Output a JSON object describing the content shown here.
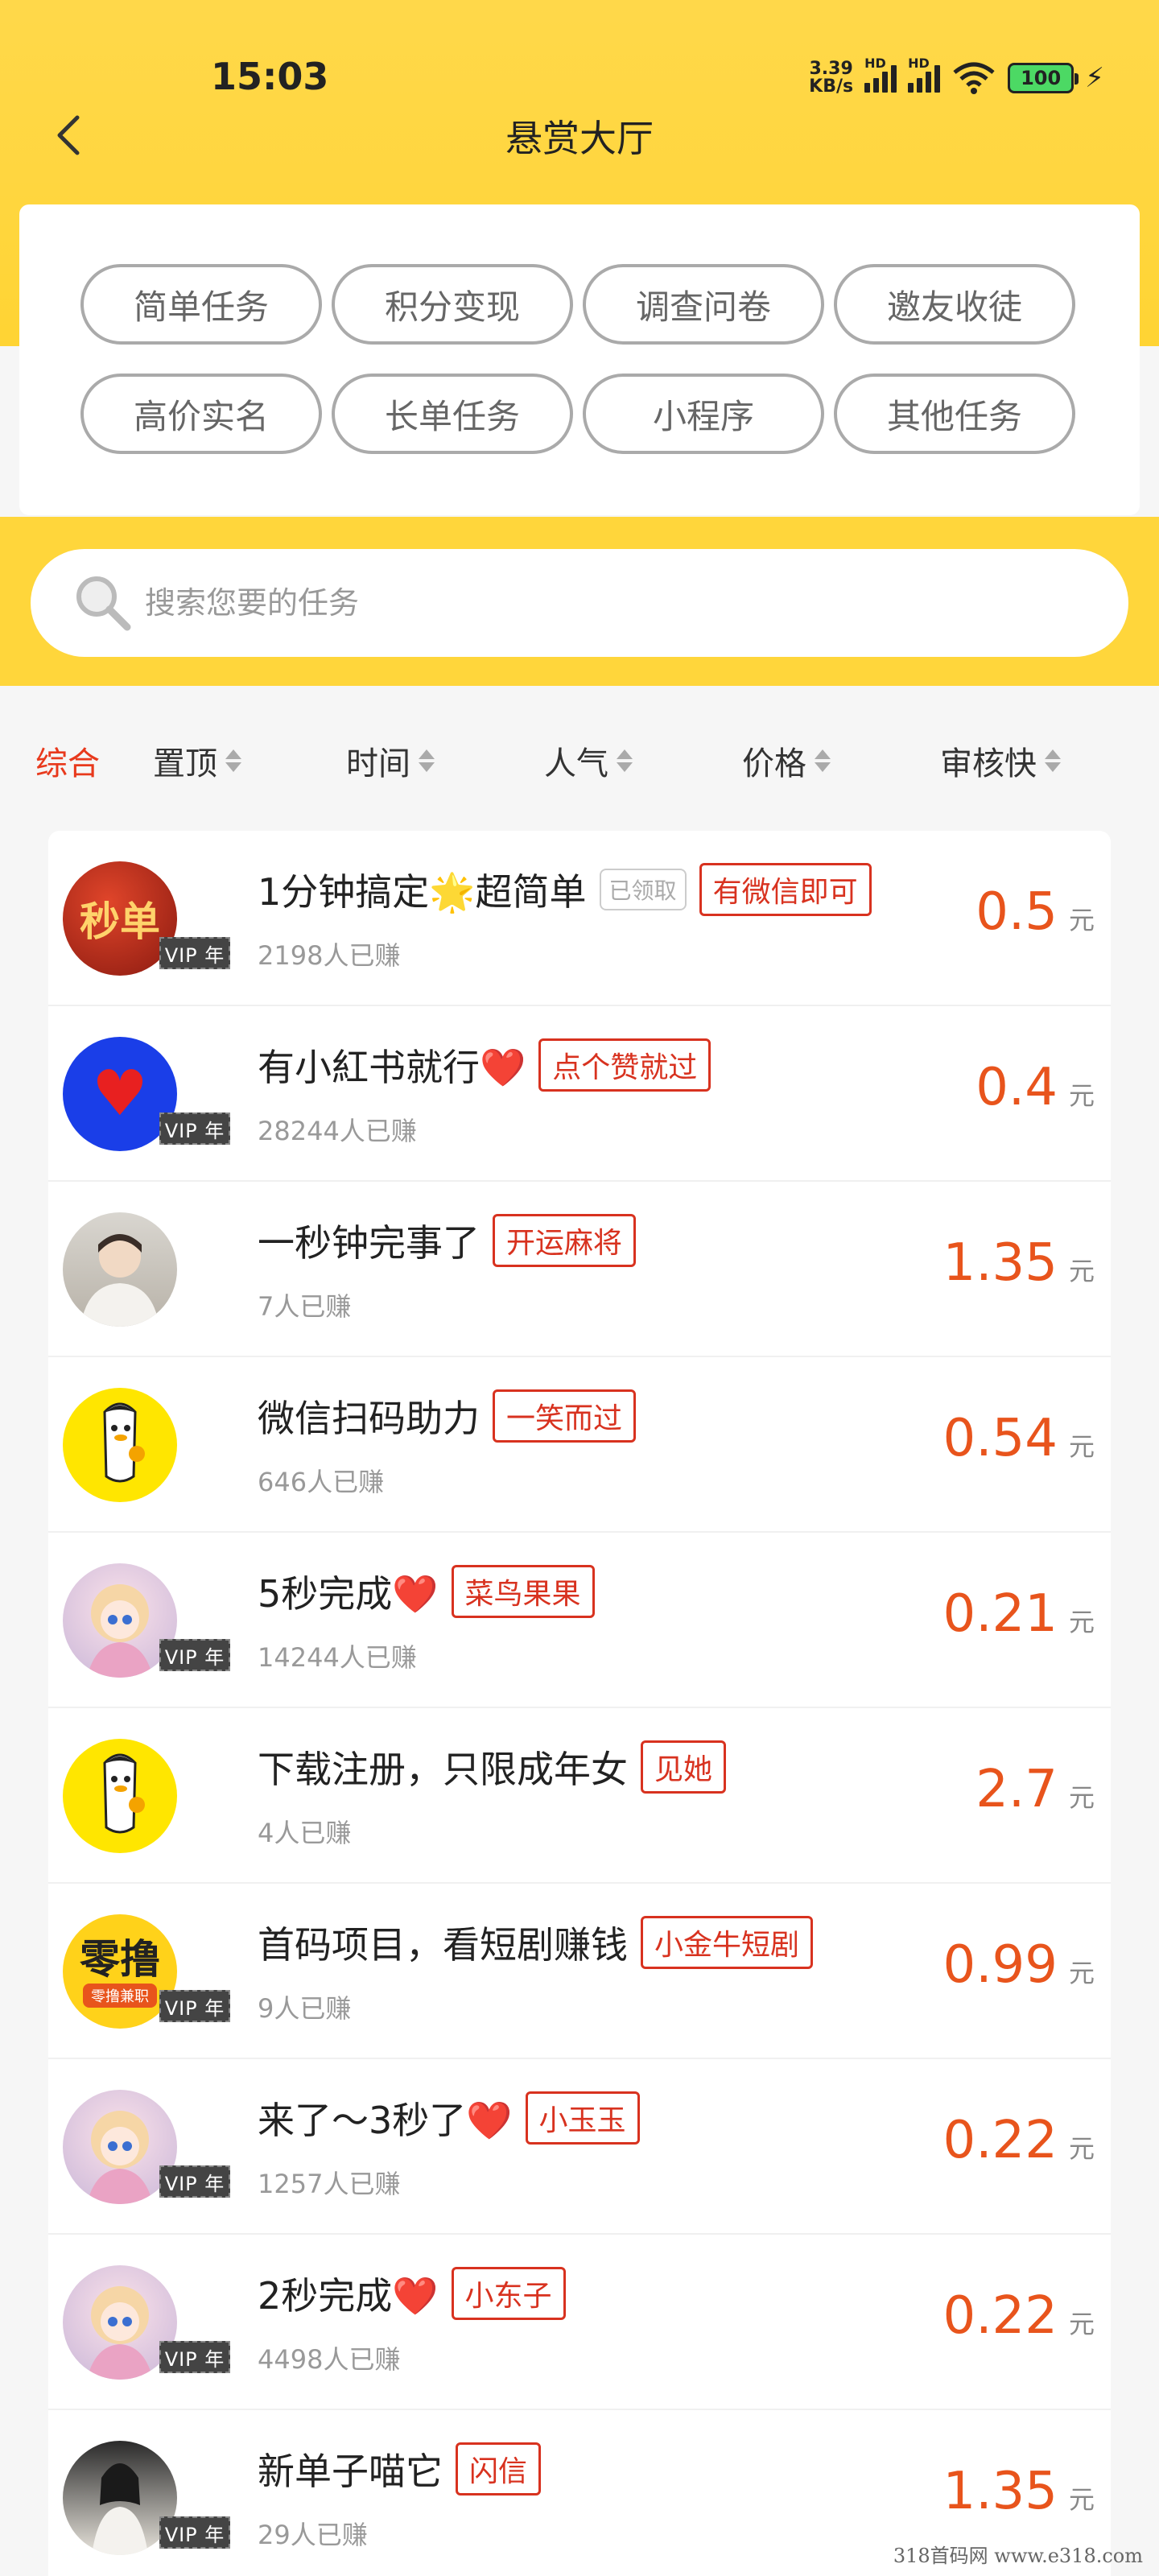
{
  "status_bar": {
    "time": "15:03",
    "net_speed_value": "3.39",
    "net_speed_unit": "KB/s",
    "hd1": "HD",
    "hd2": "HD",
    "battery": "100"
  },
  "nav": {
    "title": "悬赏大厅"
  },
  "categories": [
    "简单任务",
    "积分变现",
    "调查问卷",
    "邀友收徒",
    "高价实名",
    "长单任务",
    "小程序",
    "其他任务"
  ],
  "search": {
    "placeholder": "搜索您要的任务"
  },
  "sort": {
    "items": [
      "综合",
      "置顶",
      "时间",
      "人气",
      "价格",
      "审核快"
    ],
    "active": "综合"
  },
  "tasks": [
    {
      "title": "1分钟搞定🌟超简单",
      "claimed": "已领取",
      "tag": "有微信即可",
      "earned": "2198人已赚",
      "price": "0.5",
      "unit": "元",
      "vip": "VIP 年",
      "avatar_text": "秒单"
    },
    {
      "title": "有小紅书就行❤️",
      "tag": "点个赞就过",
      "earned": "28244人已赚",
      "price": "0.4",
      "unit": "元",
      "vip": "VIP 年"
    },
    {
      "title": "一秒钟完事了",
      "tag": "开运麻将",
      "earned": "7人已赚",
      "price": "1.35",
      "unit": "元"
    },
    {
      "title": "微信扫码助力",
      "tag": "一笑而过",
      "earned": "646人已赚",
      "price": "0.54",
      "unit": "元"
    },
    {
      "title": "5秒完成❤️",
      "tag": "菜鸟果果",
      "earned": "14244人已赚",
      "price": "0.21",
      "unit": "元",
      "vip": "VIP 年"
    },
    {
      "title": "下载注册，只限成年女",
      "tag": "见她",
      "earned": "4人已赚",
      "price": "2.7",
      "unit": "元"
    },
    {
      "title": "首码项目，看短剧赚钱",
      "tag": "小金牛短剧",
      "earned": "9人已赚",
      "price": "0.99",
      "unit": "元",
      "vip": "VIP 年",
      "avatar_text": "零撸",
      "avatar_sub": "零撸兼职"
    },
    {
      "title": "来了～3秒了❤️",
      "tag": "小玉玉",
      "earned": "1257人已赚",
      "price": "0.22",
      "unit": "元",
      "vip": "VIP 年"
    },
    {
      "title": "2秒完成❤️",
      "tag": "小东子",
      "earned": "4498人已赚",
      "price": "0.22",
      "unit": "元",
      "vip": "VIP 年"
    },
    {
      "title": "新单子喵它",
      "tag": "闪信",
      "earned": "29人已赚",
      "price": "1.35",
      "unit": "元",
      "vip": "VIP 年"
    }
  ],
  "watermark": "318首码网  www.e318.com"
}
